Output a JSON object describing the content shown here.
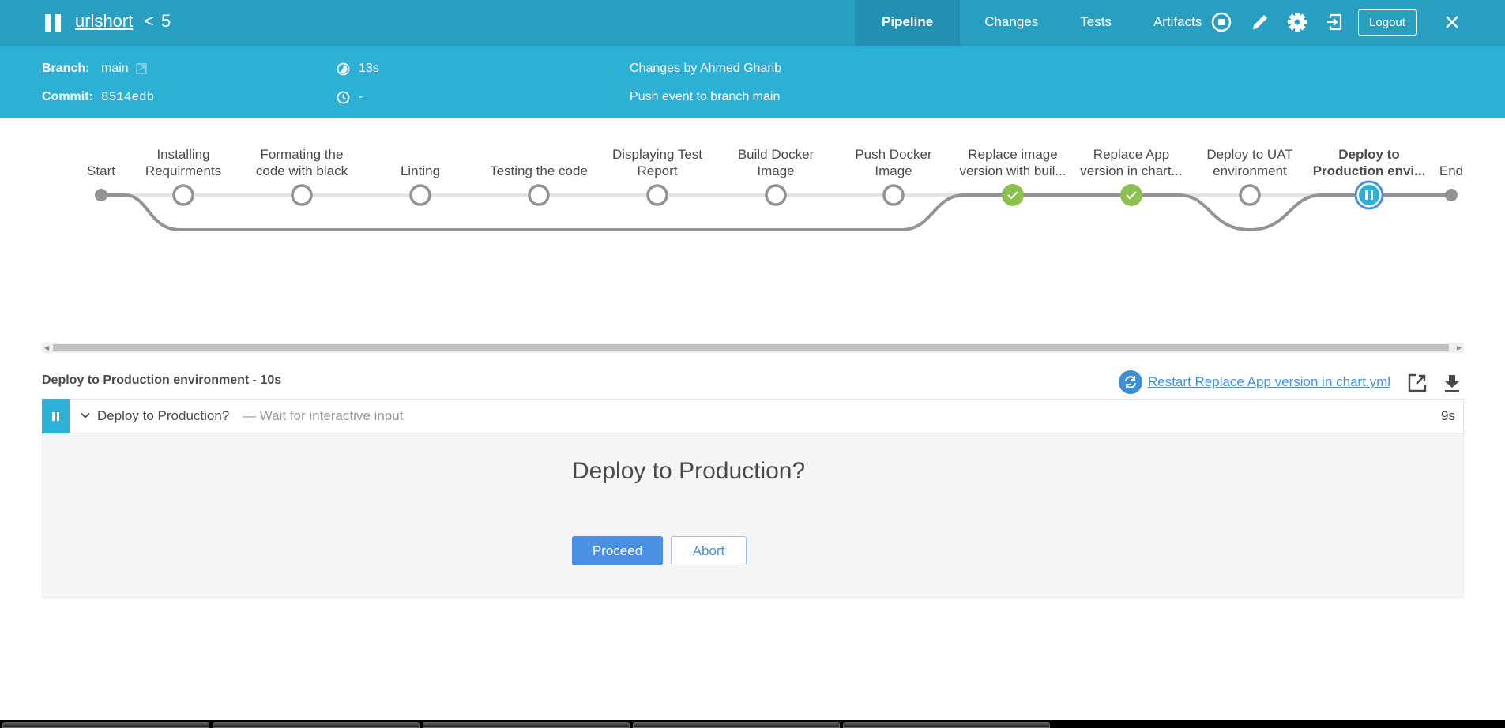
{
  "header": {
    "title": "urlshort",
    "back_glyph": "<",
    "run_number": "5",
    "status_icon": "pause-icon",
    "tabs": [
      {
        "label": "Pipeline",
        "active": true
      },
      {
        "label": "Changes",
        "active": false
      },
      {
        "label": "Tests",
        "active": false
      },
      {
        "label": "Artifacts",
        "active": false
      }
    ],
    "icons": [
      "stop-icon",
      "edit-icon",
      "gear-icon",
      "login-icon"
    ],
    "logout_label": "Logout",
    "close_icon": "close-icon"
  },
  "run_info": {
    "branch_label": "Branch:",
    "branch_value": "main",
    "commit_label": "Commit:",
    "commit_value": "8514edb",
    "duration": "13s",
    "started": "-",
    "changes": "Changes by Ahmed Gharib",
    "cause": "Push event to branch main"
  },
  "pipeline": {
    "stages": [
      {
        "label_lines": [
          "",
          "Start"
        ],
        "state": "start"
      },
      {
        "label_lines": [
          "Installing",
          "Requirments"
        ],
        "state": "not_built"
      },
      {
        "label_lines": [
          "Formating the",
          "code with black"
        ],
        "state": "not_built"
      },
      {
        "label_lines": [
          "",
          "Linting"
        ],
        "state": "not_built"
      },
      {
        "label_lines": [
          "",
          "Testing the code"
        ],
        "state": "not_built"
      },
      {
        "label_lines": [
          "Displaying Test",
          "Report"
        ],
        "state": "not_built"
      },
      {
        "label_lines": [
          "Build Docker",
          "Image"
        ],
        "state": "not_built"
      },
      {
        "label_lines": [
          "Push Docker",
          "Image"
        ],
        "state": "not_built"
      },
      {
        "label_lines": [
          "Replace image",
          "version with buil..."
        ],
        "state": "success"
      },
      {
        "label_lines": [
          "Replace App",
          "version in chart..."
        ],
        "state": "success"
      },
      {
        "label_lines": [
          "Deploy to UAT",
          "environment"
        ],
        "state": "not_built"
      },
      {
        "label_lines": [
          "Deploy to",
          "Production envi..."
        ],
        "state": "paused",
        "selected": true
      },
      {
        "label_lines": [
          "",
          "End"
        ],
        "state": "end"
      }
    ],
    "colors": {
      "success": "#8cc04f",
      "paused": "#2db0d6",
      "selected_ring": "#4a90e2",
      "line": "#949393",
      "line_light": "#e4e4e4"
    }
  },
  "step_detail": {
    "title": "Deploy to Production environment - 10s",
    "restart_label": "Restart Replace App version in chart.yml",
    "step": {
      "name": "Deploy to Production?",
      "description": "— Wait for interactive input",
      "duration": "9s"
    },
    "input": {
      "question": "Deploy to Production?",
      "proceed_label": "Proceed",
      "abort_label": "Abort"
    }
  }
}
